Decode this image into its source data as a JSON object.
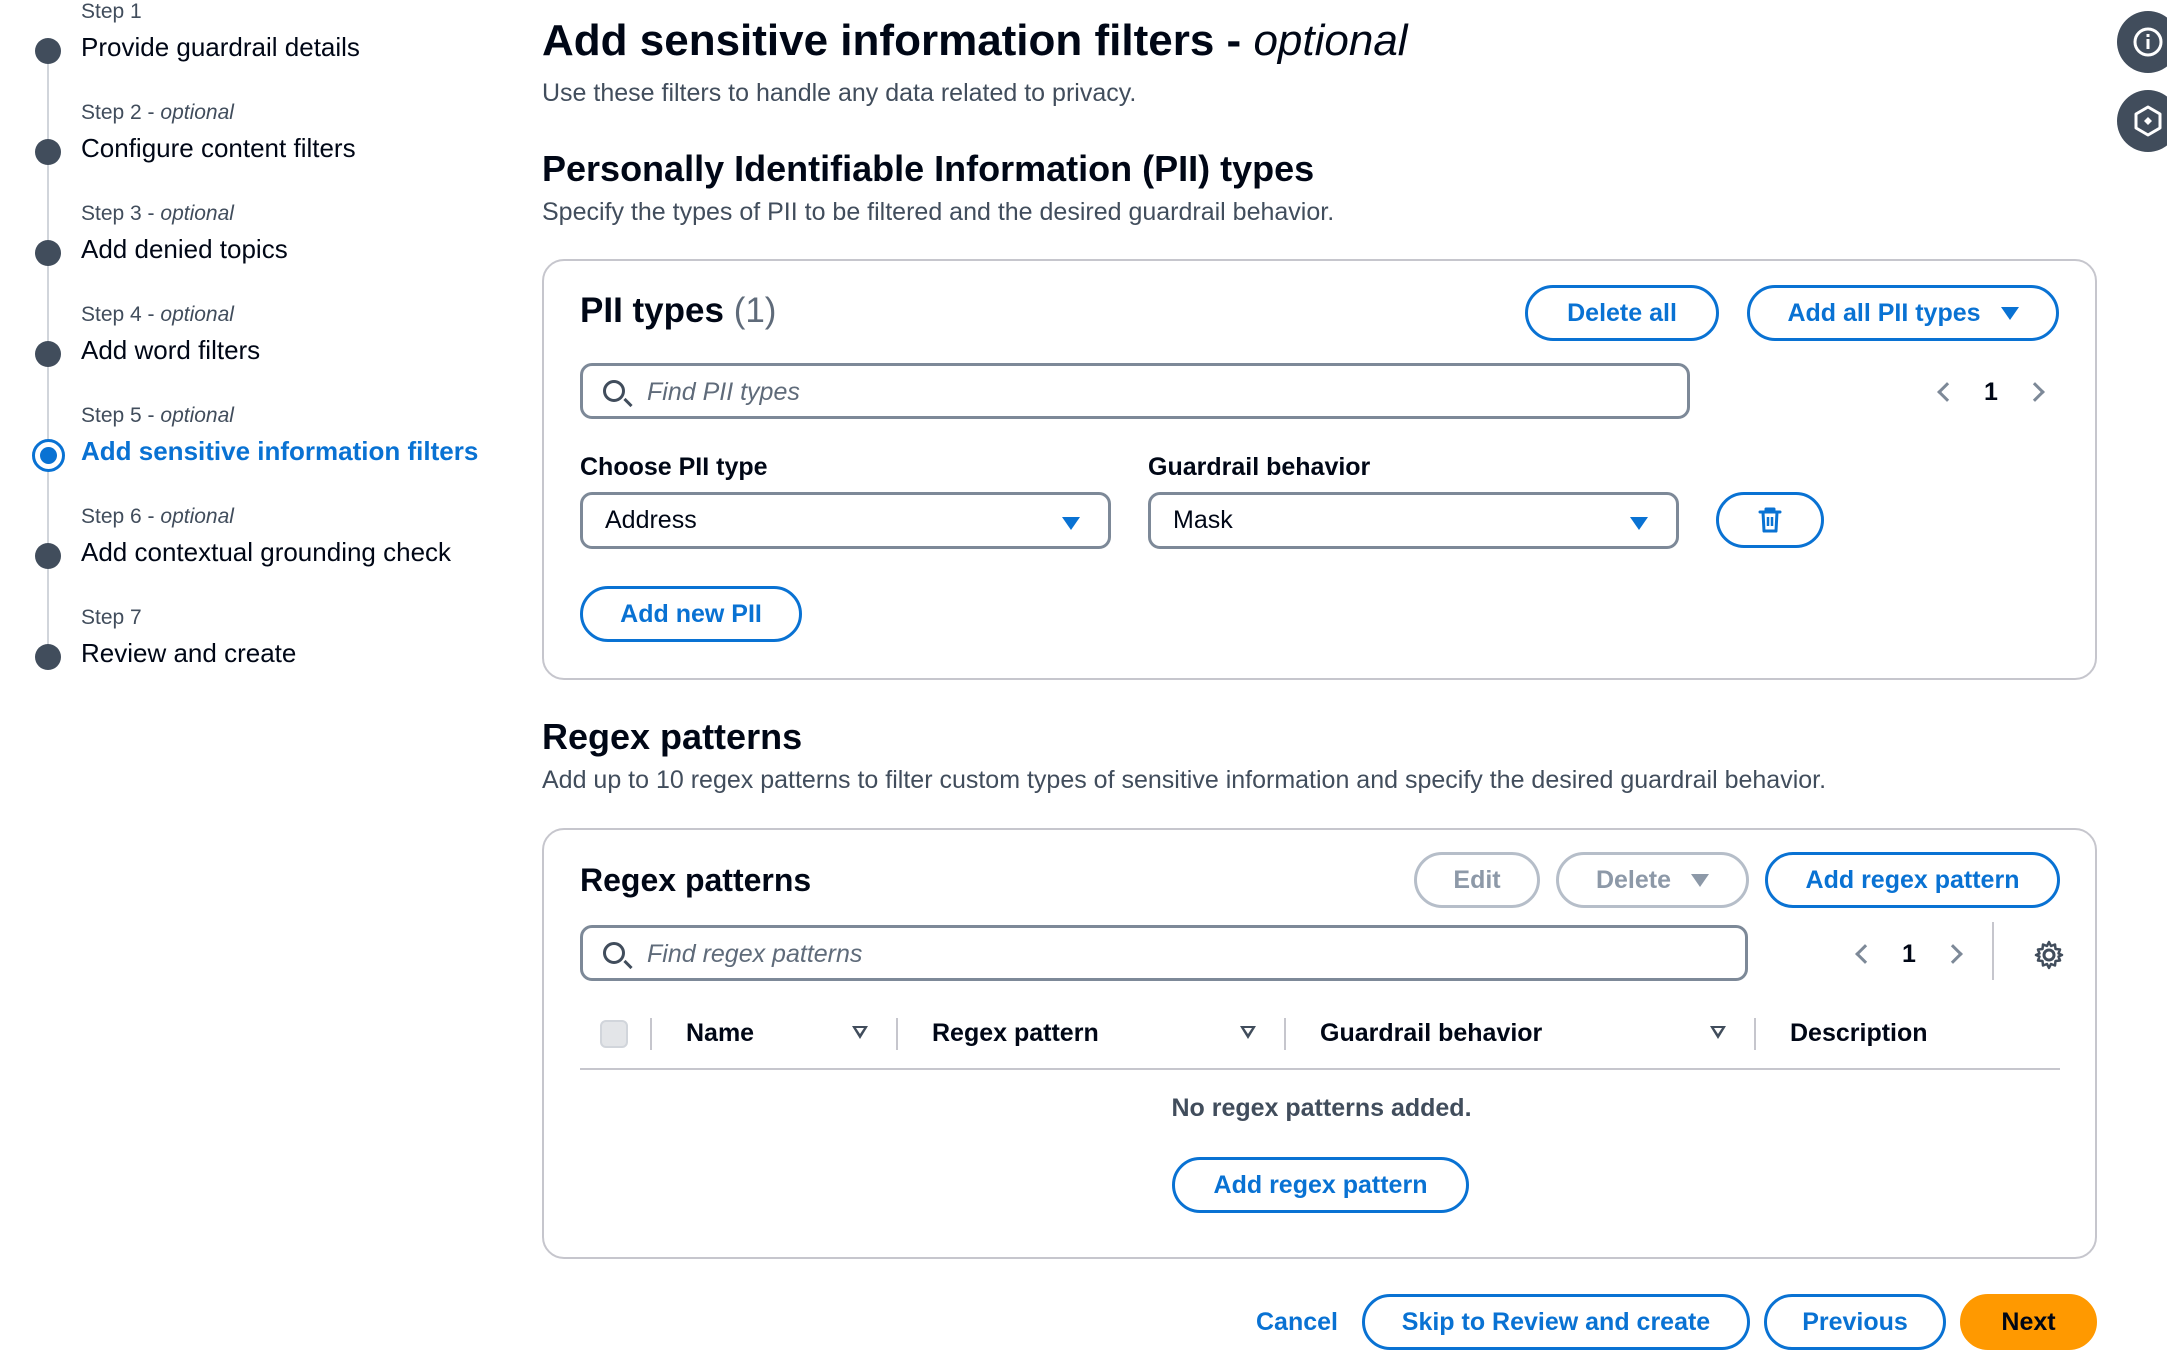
{
  "stepper": {
    "steps": [
      {
        "num": "Step 1",
        "optional": "",
        "title": "Provide guardrail details"
      },
      {
        "num": "Step 2 - ",
        "optional": "optional",
        "title": "Configure content filters"
      },
      {
        "num": "Step 3 - ",
        "optional": "optional",
        "title": "Add denied topics"
      },
      {
        "num": "Step 4 - ",
        "optional": "optional",
        "title": "Add word filters"
      },
      {
        "num": "Step 5 - ",
        "optional": "optional",
        "title": "Add sensitive information filters"
      },
      {
        "num": "Step 6 - ",
        "optional": "optional",
        "title": "Add contextual grounding check"
      },
      {
        "num": "Step 7",
        "optional": "",
        "title": "Review and create"
      }
    ],
    "active_index": 4
  },
  "header": {
    "title": "Add sensitive information filters - ",
    "title_optional": "optional",
    "description": "Use these filters to handle any data related to privacy."
  },
  "pii_section": {
    "heading": "Personally Identifiable Information (PII) types",
    "description": "Specify the types of PII to be filtered and the desired guardrail behavior.",
    "card_title": "PII types",
    "count": "(1)",
    "delete_all_label": "Delete all",
    "add_all_label": "Add all PII types",
    "search_placeholder": "Find PII types",
    "page_number": "1",
    "choose_label": "Choose PII type",
    "behavior_label": "Guardrail behavior",
    "pii_type_value": "Address",
    "behavior_value": "Mask",
    "add_new_label": "Add new PII"
  },
  "regex_section": {
    "heading": "Regex patterns",
    "description": "Add up to 10 regex patterns to filter custom types of sensitive information and specify the desired guardrail behavior.",
    "card_title": "Regex patterns",
    "edit_label": "Edit",
    "delete_label": "Delete",
    "add_label": "Add regex pattern",
    "search_placeholder": "Find regex patterns",
    "page_number": "1",
    "columns": [
      "Name",
      "Regex pattern",
      "Guardrail behavior",
      "Description"
    ],
    "empty_text": "No regex patterns added.",
    "empty_add_label": "Add regex pattern"
  },
  "footer": {
    "cancel_label": "Cancel",
    "skip_label": "Skip to Review and create",
    "previous_label": "Previous",
    "next_label": "Next"
  },
  "colors": {
    "accent": "#0972d3",
    "primary_button": "#ff9900",
    "text": "#000716"
  }
}
